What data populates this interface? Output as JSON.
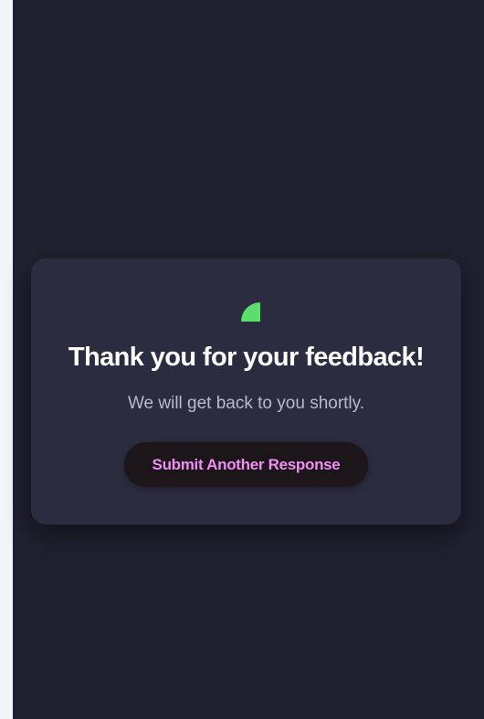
{
  "confirmation": {
    "icon": "success-check-icon",
    "icon_color": "#5cde6d",
    "title": "Thank you for your feedback!",
    "message": "We will get back to you shortly.",
    "button_label": "Submit Another Response",
    "button_text_color": "#f08ff4"
  },
  "colors": {
    "page_background": "#20202f",
    "card_background": "#2c2c40",
    "left_strip": "#f3f4f8",
    "button_background": "#1c1519"
  }
}
